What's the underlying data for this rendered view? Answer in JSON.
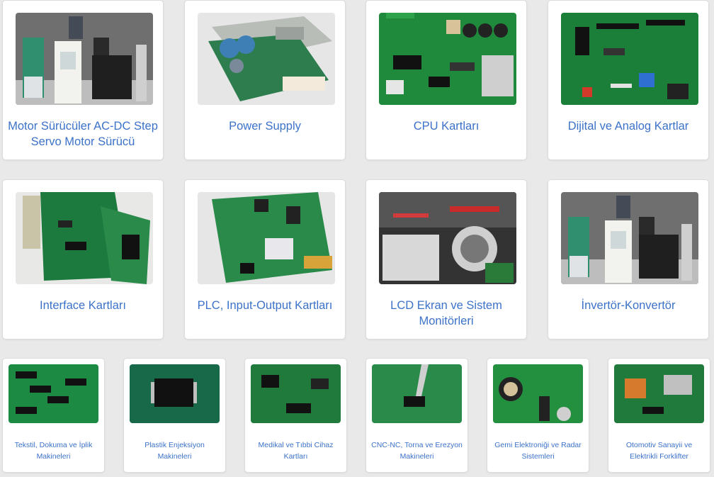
{
  "categories_large": [
    {
      "label": "Motor Sürücüler AC-DC Step Servo Motor Sürücü",
      "icon": "motor-driver-photo"
    },
    {
      "label": "Power Supply",
      "icon": "power-supply-photo"
    },
    {
      "label": "CPU Kartları",
      "icon": "cpu-board-photo"
    },
    {
      "label": "Dijital ve Analog Kartlar",
      "icon": "digital-analog-board-photo"
    },
    {
      "label": "Interface Kartları",
      "icon": "interface-board-photo"
    },
    {
      "label": "PLC, Input-Output Kartları",
      "icon": "plc-io-board-photo"
    },
    {
      "label": "LCD Ekran ve Sistem Monitörleri",
      "icon": "lcd-monitor-photo"
    },
    {
      "label": "İnvertör-Konvertör",
      "icon": "inverter-converter-photo"
    }
  ],
  "categories_small": [
    {
      "label": "Tekstil, Dokuma ve İplik Makineleri",
      "icon": "textile-pcb-photo"
    },
    {
      "label": "Plastik Enjeksiyon Makineleri",
      "icon": "plastic-injection-chip-photo"
    },
    {
      "label": "Medikal ve Tıbbi Cihaz Kartları",
      "icon": "medical-pcb-photo"
    },
    {
      "label": "CNC-NC, Torna ve Erezyon Makineleri",
      "icon": "cnc-soldering-photo"
    },
    {
      "label": "Gemi Elektroniği ve Radar Sistemleri",
      "icon": "marine-pcb-photo"
    },
    {
      "label": "Otomotiv Sanayii ve Elektrikli Forklifter",
      "icon": "automotive-pcb-photo"
    }
  ],
  "colors": {
    "link": "#3c72c9",
    "background": "#e9e9e9",
    "pcb_green": "#1f8a3c"
  }
}
